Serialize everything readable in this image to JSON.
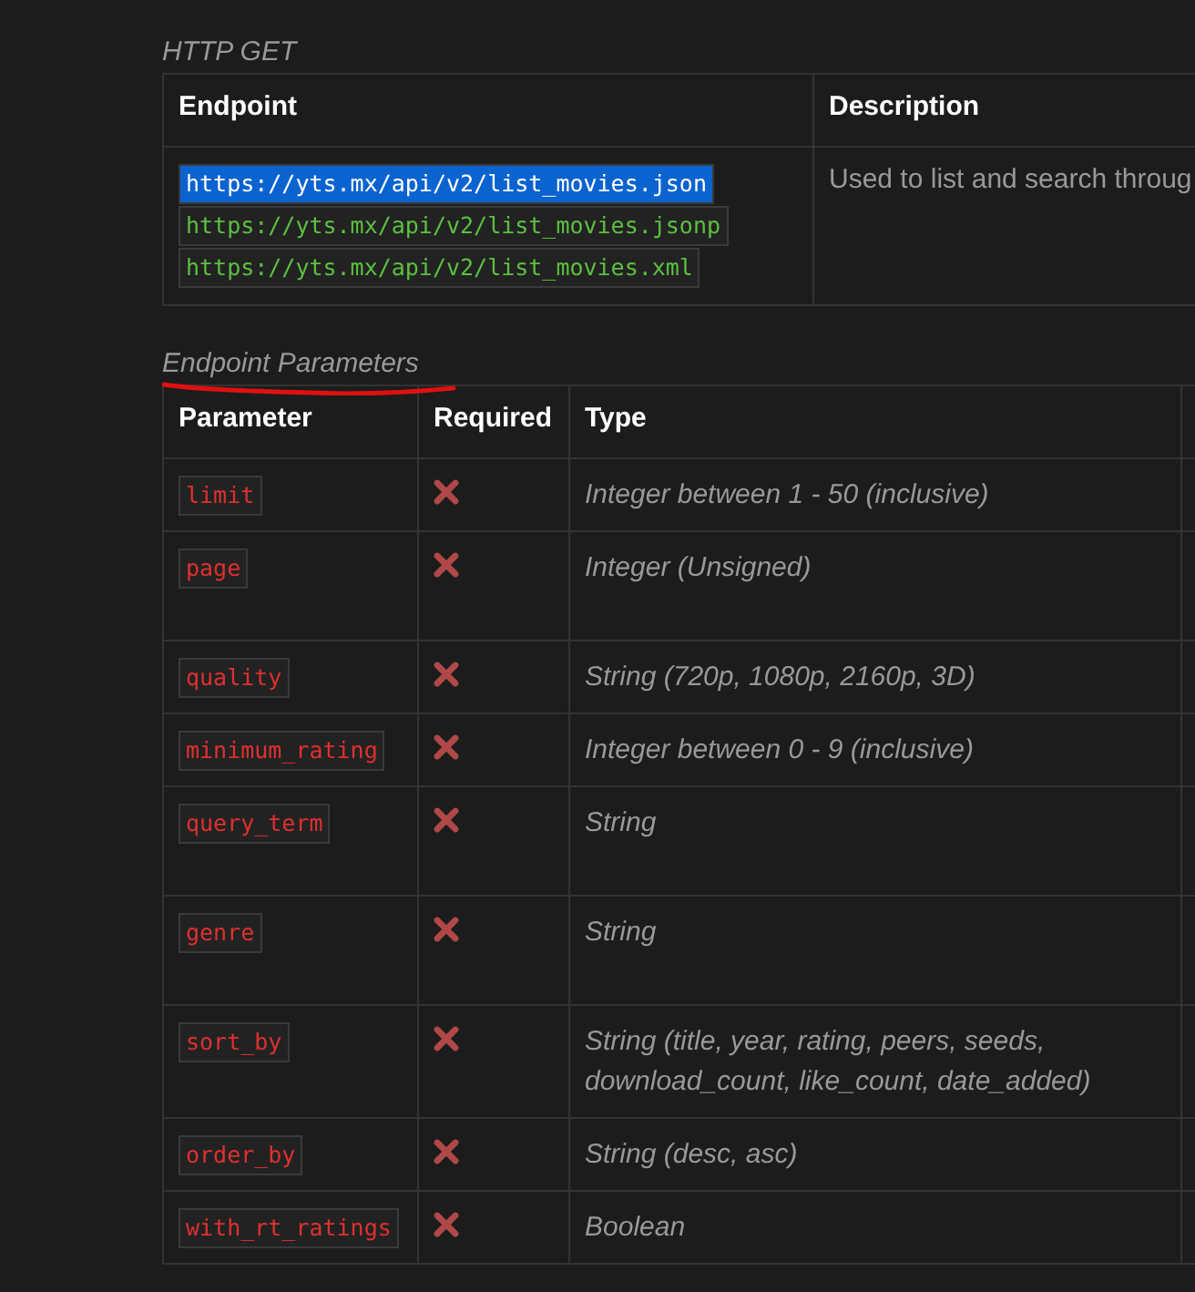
{
  "endpoint_section": {
    "title": "HTTP GET",
    "table": {
      "columns": [
        "Endpoint",
        "Description"
      ],
      "endpoints": [
        {
          "url": "https://yts.mx/api/v2/list_movies.json",
          "highlighted": true
        },
        {
          "url": "https://yts.mx/api/v2/list_movies.jsonp",
          "highlighted": false
        },
        {
          "url": "https://yts.mx/api/v2/list_movies.xml",
          "highlighted": false
        }
      ],
      "description": "Used to list and search throug"
    }
  },
  "parameters_section": {
    "title": "Endpoint Parameters",
    "table": {
      "columns": [
        "Parameter",
        "Required",
        "Type"
      ],
      "rows": [
        {
          "parameter": "limit",
          "required": false,
          "type": "Integer between 1 - 50 (inclusive)"
        },
        {
          "parameter": "page",
          "required": false,
          "type": "Integer (Unsigned)"
        },
        {
          "parameter": "quality",
          "required": false,
          "type": "String (720p, 1080p, 2160p, 3D)"
        },
        {
          "parameter": "minimum_rating",
          "required": false,
          "type": "Integer between 0 - 9 (inclusive)"
        },
        {
          "parameter": "query_term",
          "required": false,
          "type": "String"
        },
        {
          "parameter": "genre",
          "required": false,
          "type": "String"
        },
        {
          "parameter": "sort_by",
          "required": false,
          "type": "String (title, year, rating, peers, seeds, download_count, like_count, date_added)"
        },
        {
          "parameter": "order_by",
          "required": false,
          "type": "String (desc, asc)"
        },
        {
          "parameter": "with_rt_ratings",
          "required": false,
          "type": "Boolean"
        }
      ]
    }
  }
}
